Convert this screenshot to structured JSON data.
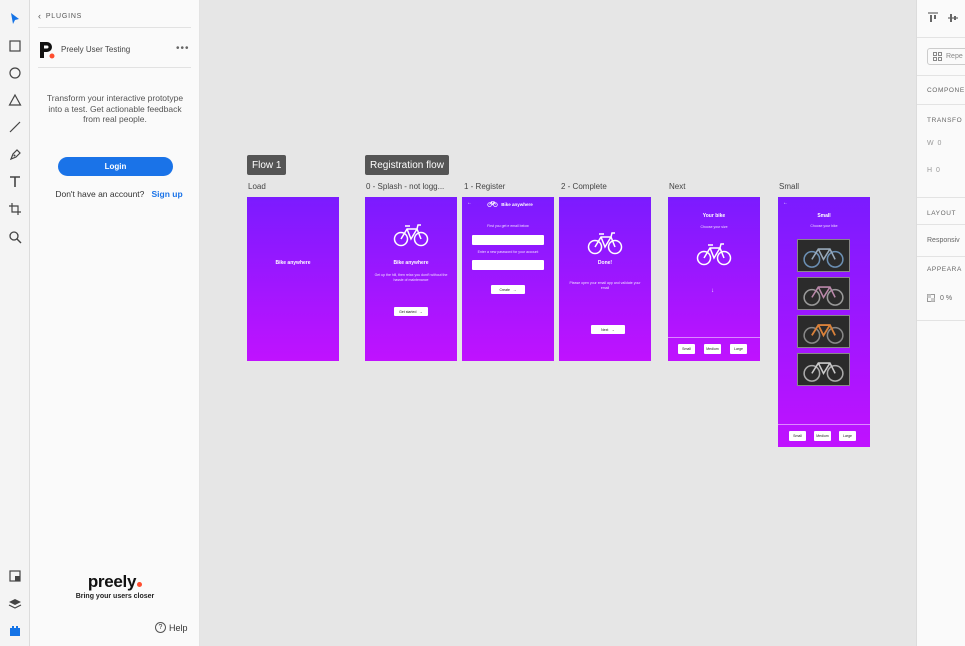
{
  "plugin": {
    "back_label": "PLUGINS",
    "name": "Preely User Testing",
    "more": "•••",
    "description": "Transform your interactive prototype into a test. Get actionable feedback from real people.",
    "login_label": "Login",
    "no_account": "Don't have an account?",
    "signup_label": "Sign up",
    "brand_name": "preely",
    "brand_tagline": "Bring your users closer",
    "help_label": "Help"
  },
  "toolbar": {
    "tools": [
      "select-icon",
      "rectangle-icon",
      "ellipse-icon",
      "triangle-icon",
      "line-icon",
      "pen-icon",
      "text-icon",
      "artboard-icon",
      "zoom-icon"
    ],
    "bottom_tools": [
      "assets-icon",
      "layers-icon",
      "plugins-icon"
    ]
  },
  "right_panel": {
    "repeat_label": "Repe",
    "component_label": "COMPONE",
    "transform_label": "TRANSFO",
    "w_label": "W",
    "w_value": "0",
    "h_label": "H",
    "h_value": "0",
    "layout_label": "LAYOUT",
    "responsive_label": "Responsiv",
    "appearance_label": "APPEARA",
    "opacity_value": "0 %"
  },
  "canvas": {
    "flows": [
      "Flow 1",
      "Registration flow"
    ],
    "artboards": {
      "load": {
        "label": "Load",
        "title": "Bike anywhere"
      },
      "splash": {
        "label": "0 - Splash - not logg...",
        "title": "Bike anywhere",
        "sub": "Get up the hill, then relax you dont't without the hassle of maintenance",
        "button": "Get started"
      },
      "register": {
        "label": "1 - Register",
        "header": "Bike anywhere",
        "field1_label": "First you get e email below",
        "field2_label": "Enter a new password for your account",
        "button": "Create"
      },
      "complete": {
        "label": "2 - Complete",
        "title": "Done!",
        "sub": "Please open your email app and validate your email",
        "button": "Next"
      },
      "next": {
        "label": "Next",
        "title": "Your bike",
        "sub": "Choose your size",
        "sizes": [
          "Small",
          "Medium",
          "Large"
        ]
      },
      "small": {
        "label": "Small",
        "title": "Small",
        "sub": "Choose your bike",
        "sizes": [
          "Small",
          "Medium",
          "Large"
        ]
      }
    }
  },
  "colors": {
    "artboard_top": "#7b1bff",
    "artboard_bottom": "#c012ff",
    "login_button": "#1a73e8",
    "brand_dot": "#ff4d2e"
  }
}
